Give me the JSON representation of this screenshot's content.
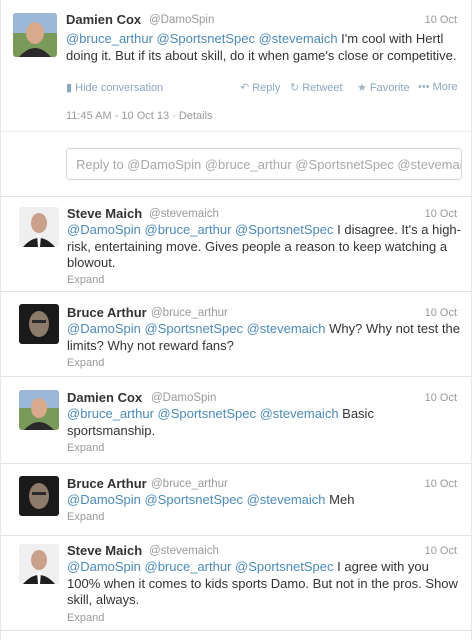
{
  "main_tweet": {
    "name": "Damien Cox",
    "handle": "@DamoSpin",
    "date": "10 Oct",
    "mentions": "@bruce_arthur @SportsnetSpec @stevemaich",
    "body": " I'm cool with Hertl doing it. But if its about skill, do it when game's close or competitive.",
    "hide_label": "Hide conversation",
    "reply_label": "Reply",
    "retweet_label": "Retweet",
    "favorite_label": "Favorite",
    "more_label": "More",
    "timestamp": "11:45 AM - 10 Oct 13",
    "details_label": "· Details",
    "reply_placeholder": "Reply to @DamoSpin @bruce_arthur @SportsnetSpec @stevemai..."
  },
  "replies": [
    {
      "name": "Steve Maich",
      "handle": "@stevemaich",
      "date": "10 Oct",
      "mentions": "@DamoSpin @bruce_arthur @SportsnetSpec",
      "body": " I disagree. It's a high-risk, entertaining move. Gives people a reason to keep watching a blowout.",
      "expand": "Expand"
    },
    {
      "name": "Bruce Arthur",
      "handle": "@bruce_arthur",
      "date": "10 Oct",
      "mentions": "@DamoSpin @SportsnetSpec @stevemaich",
      "body": " Why? Why not test the limits? Why not reward fans?",
      "expand": "Expand"
    },
    {
      "name": "Damien Cox",
      "handle": "@DamoSpin",
      "date": "10 Oct",
      "mentions": "@bruce_arthur @SportsnetSpec @stevemaich",
      "body": "  Basic sportsmanship.",
      "expand": "Expand"
    },
    {
      "name": "Bruce Arthur",
      "handle": "@bruce_arthur",
      "date": "10 Oct",
      "mentions": "@DamoSpin @SportsnetSpec @stevemaich",
      "body": " Meh",
      "expand": "Expand"
    },
    {
      "name": "Steve Maich",
      "handle": "@stevemaich",
      "date": "10 Oct",
      "mentions": "@DamoSpin @bruce_arthur @SportsnetSpec",
      "body": " I agree with you 100% when it comes to kids sports Damo. But not in the pros. Show skill, always.",
      "expand": "Expand"
    }
  ],
  "colors": {
    "mention": "#4a8ab8",
    "meta": "#999999",
    "action": "#8aa7c2"
  },
  "icons": {
    "hide": "chat-bubble-icon",
    "reply": "reply-arrow-icon",
    "retweet": "retweet-icon",
    "favorite": "star-icon",
    "more": "ellipsis-icon"
  }
}
